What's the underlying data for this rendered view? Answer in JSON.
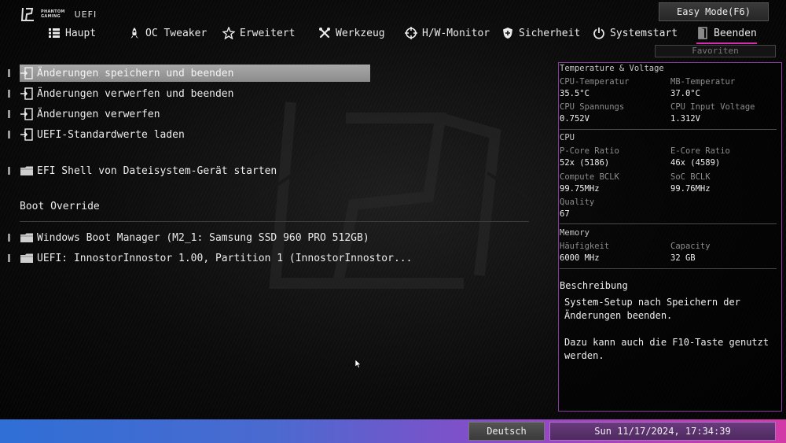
{
  "brand": {
    "logo_line1": "PHANTOM",
    "logo_line2": "GAMING",
    "uefi": "UEFI"
  },
  "header": {
    "easy_mode": "Easy Mode(F6)",
    "favorites": "Favoriten"
  },
  "nav": {
    "tabs": [
      {
        "label": "Haupt",
        "icon": "list-icon"
      },
      {
        "label": "OC Tweaker",
        "icon": "rocket-icon"
      },
      {
        "label": "Erweitert",
        "icon": "star-icon"
      },
      {
        "label": "Werkzeug",
        "icon": "tools-icon"
      },
      {
        "label": "H/W-Monitor",
        "icon": "crosshair-icon"
      },
      {
        "label": "Sicherheit",
        "icon": "shield-icon"
      },
      {
        "label": "Systemstart",
        "icon": "power-icon"
      },
      {
        "label": "Beenden",
        "icon": "exit-door-icon"
      }
    ],
    "active": "Beenden"
  },
  "menu": {
    "items": [
      "Änderungen speichern und beenden",
      "Änderungen verwerfen und beenden",
      "Änderungen verwerfen",
      "UEFI-Standardwerte laden",
      "EFI Shell von Dateisystem-Gerät starten"
    ],
    "boot_override_label": "Boot Override",
    "boot_items": [
      "Windows Boot Manager (M2_1: Samsung SSD 960 PRO 512GB)",
      "UEFI: InnostorInnostor 1.00, Partition 1 (InnostorInnostor..."
    ]
  },
  "panel": {
    "tv_title": "Temperature & Voltage",
    "cpu_temp_label": "CPU-Temperatur",
    "cpu_temp": "35.5°C",
    "mb_temp_label": "MB-Temperatur",
    "mb_temp": "37.0°C",
    "cpu_volt_label": "CPU Spannungs",
    "cpu_volt": "0.752V",
    "cpu_input_label": "CPU Input Voltage",
    "cpu_input": "1.312V",
    "cpu_title": "CPU",
    "pcore_label": "P-Core Ratio",
    "pcore": "52x (5186)",
    "ecore_label": "E-Core Ratio",
    "ecore": "46x (4589)",
    "compute_label": "Compute BCLK",
    "compute": "99.75MHz",
    "soc_label": "SoC BCLK",
    "soc": "99.76MHz",
    "quality_label": "Quality",
    "quality": "67",
    "memory_title": "Memory",
    "freq_label": "Häufigkeit",
    "freq": "6000 MHz",
    "cap_label": "Capacity",
    "cap": "32 GB",
    "desc_title": "Beschreibung",
    "desc_text": "System-Setup nach Speichern der\nÄnderungen beenden.\n\nDazu kann auch die F10-Taste genutzt\nwerden."
  },
  "footer": {
    "language": "Deutsch",
    "datetime": "Sun 11/17/2024, 17:34:39"
  }
}
